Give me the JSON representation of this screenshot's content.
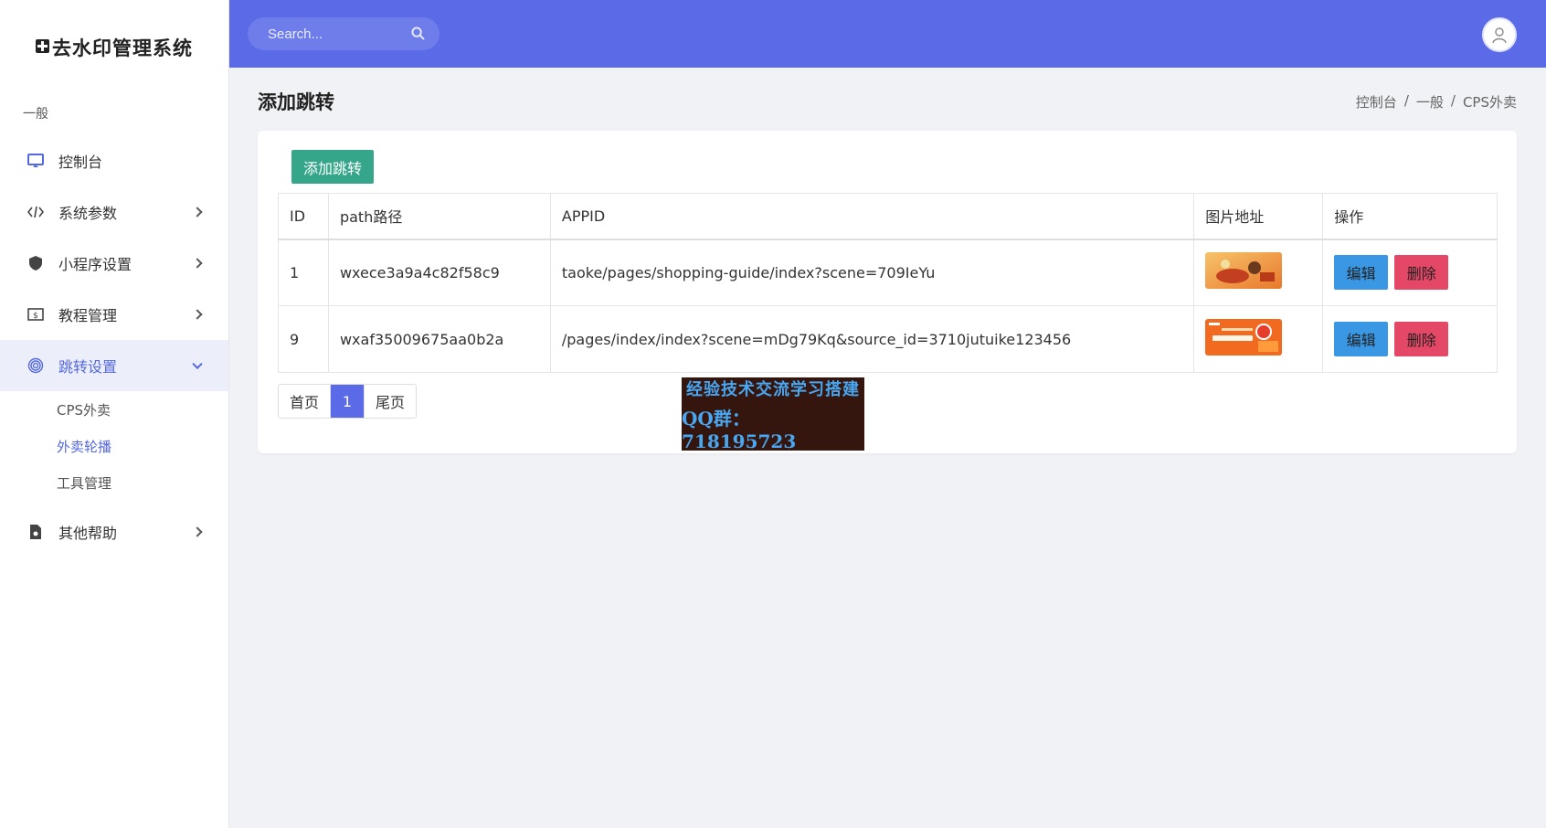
{
  "brand": {
    "title": "去水印管理系统"
  },
  "sidebar": {
    "section_label": "一般",
    "items": [
      {
        "label": "控制台",
        "icon": "monitor-icon"
      },
      {
        "label": "系统参数",
        "icon": "code-icon"
      },
      {
        "label": "小程序设置",
        "icon": "shield-icon"
      },
      {
        "label": "教程管理",
        "icon": "money-icon"
      },
      {
        "label": "跳转设置",
        "icon": "fingerprint-icon"
      },
      {
        "label": "其他帮助",
        "icon": "file-icon"
      }
    ],
    "sub_items": [
      {
        "label": "CPS外卖"
      },
      {
        "label": "外卖轮播"
      },
      {
        "label": "工具管理"
      }
    ]
  },
  "header": {
    "search_placeholder": "Search..."
  },
  "page": {
    "title": "添加跳转",
    "breadcrumb": [
      "控制台",
      "一般",
      "CPS外卖"
    ],
    "breadcrumb_sep": "/"
  },
  "toolbar": {
    "add_label": "添加跳转"
  },
  "table": {
    "columns": [
      "ID",
      "path路径",
      "APPID",
      "图片地址",
      "操作"
    ],
    "rows": [
      {
        "id": "1",
        "path": "wxece3a9a4c82f58c9",
        "appid": "taoke/pages/shopping-guide/index?scene=709IeYu",
        "edit": "编辑",
        "delete": "删除"
      },
      {
        "id": "9",
        "path": "wxaf35009675aa0b2a",
        "appid": "/pages/index/index?scene=mDg79Kq&source_id=3710jutuike123456",
        "edit": "编辑",
        "delete": "删除"
      }
    ]
  },
  "pagination": {
    "first": "首页",
    "current": "1",
    "last": "尾页"
  },
  "watermark": {
    "line1": "经验技术交流学习搭建",
    "line2": "QQ群：718195723"
  },
  "colors": {
    "header": "#5b6ae6",
    "accent": "#5468e0",
    "add_button": "#35a68a",
    "edit_button": "#3a97e4",
    "delete_button": "#e54766"
  }
}
